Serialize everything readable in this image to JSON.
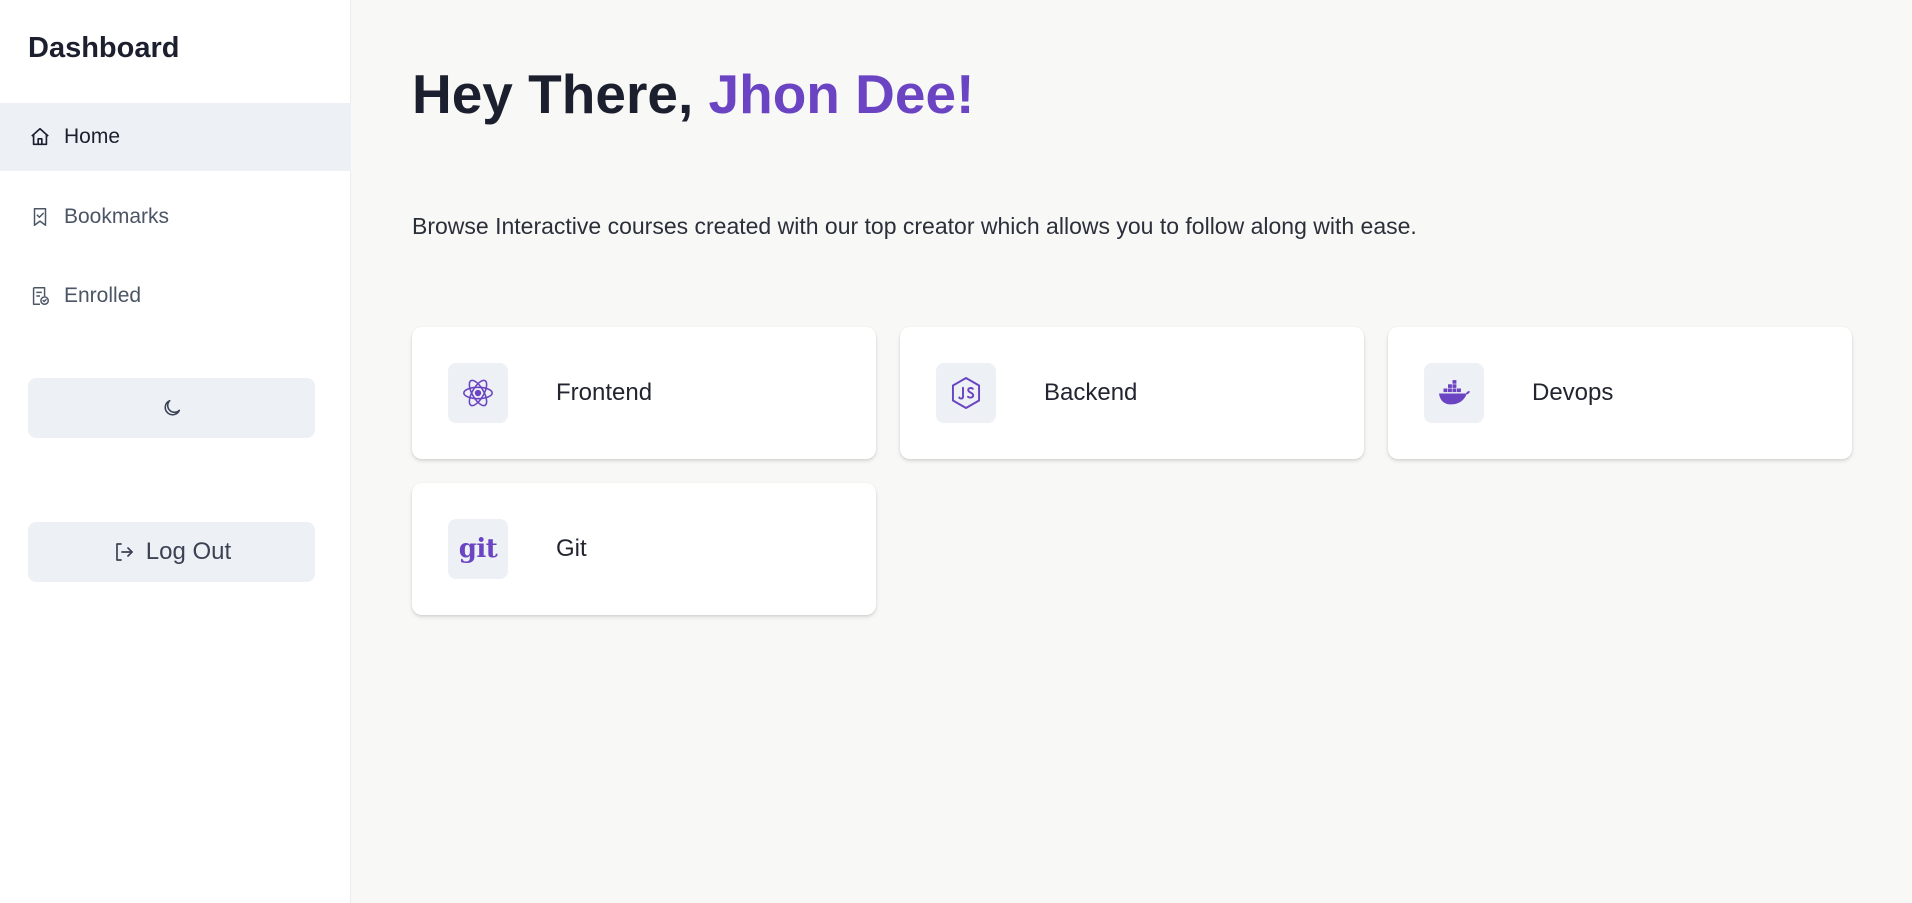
{
  "sidebar": {
    "brand": "Dashboard",
    "nav": [
      {
        "label": "Home",
        "icon": "home-icon",
        "active": true
      },
      {
        "label": "Bookmarks",
        "icon": "bookmark-icon",
        "active": false
      },
      {
        "label": "Enrolled",
        "icon": "enrolled-icon",
        "active": false
      }
    ],
    "theme_toggle_icon": "moon-icon",
    "logout_label": "Log Out",
    "logout_icon": "logout-icon"
  },
  "main": {
    "greeting_prefix": "Hey There, ",
    "greeting_name": "Jhon Dee!",
    "subtitle": "Browse Interactive courses created with our top creator which allows you to follow along with ease.",
    "categories": [
      {
        "label": "Frontend",
        "icon": "react-icon"
      },
      {
        "label": "Backend",
        "icon": "nodejs-icon"
      },
      {
        "label": "Devops",
        "icon": "docker-icon"
      },
      {
        "label": "Git",
        "icon": "git-icon",
        "icon_text": "git"
      }
    ]
  },
  "colors": {
    "accent": "#6a44c2",
    "active_bg": "#edf1f5",
    "page_bg": "#f8f8f6"
  }
}
